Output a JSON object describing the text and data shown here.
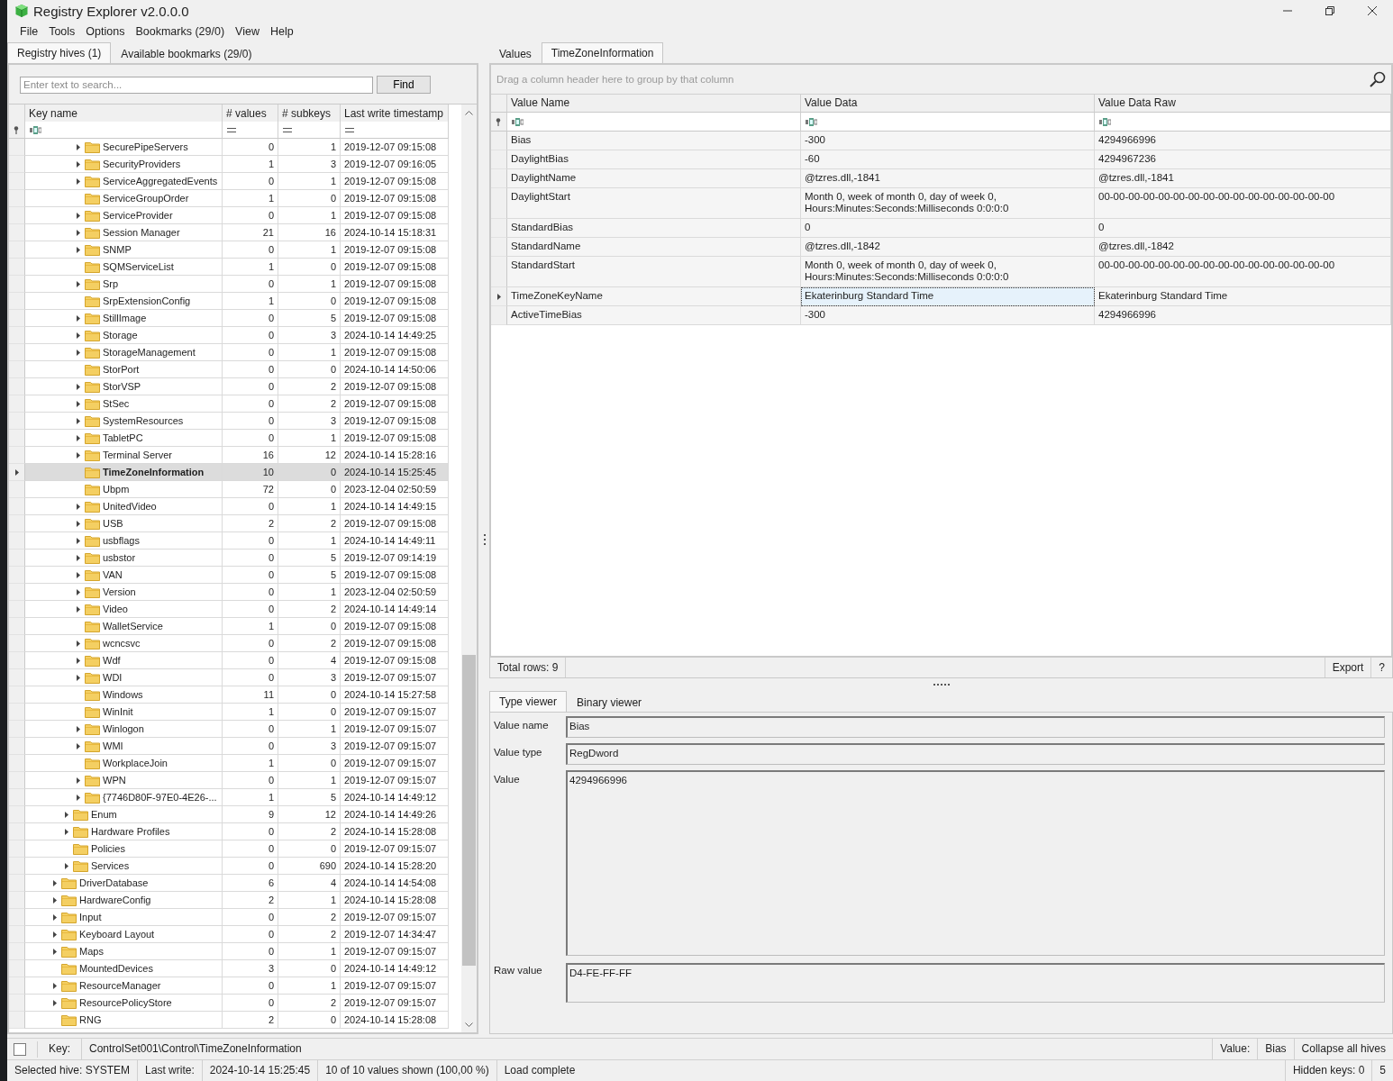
{
  "window": {
    "title": "Registry Explorer v2.0.0.0"
  },
  "menu": [
    "File",
    "Tools",
    "Options",
    "Bookmarks (29/0)",
    "View",
    "Help"
  ],
  "left_tabs": [
    {
      "label": "Registry hives (1)",
      "selected": true
    },
    {
      "label": "Available bookmarks (29/0)",
      "selected": false
    }
  ],
  "search": {
    "placeholder": "Enter text to search...",
    "button": "Find"
  },
  "key_tree": {
    "columns": [
      "Key name",
      "# values",
      "# subkeys",
      "Last write timestamp"
    ],
    "continued": {
      "continued": {
        "rows": [
          {
            "name": "SecurePipeServers",
            "values": "0",
            "subkeys": "1",
            "last_write": "2019-12-07 09:15:08",
            "expandable": true,
            "selected": false
          },
          {
            "name": "SecurityProviders",
            "values": "1",
            "subkeys": "3",
            "last_write": "2019-12-07 09:16:05",
            "expandable": true,
            "selected": false
          },
          {
            "name": "ServiceAggregatedEvents",
            "values": "0",
            "subkeys": "1",
            "last_write": "2019-12-07 09:15:08",
            "expandable": true,
            "selected": false
          },
          {
            "name": "ServiceGroupOrder",
            "values": "1",
            "subkeys": "0",
            "last_write": "2019-12-07 09:15:08",
            "expandable": false,
            "selected": false
          },
          {
            "name": "ServiceProvider",
            "values": "0",
            "subkeys": "1",
            "last_write": "2019-12-07 09:15:08",
            "expandable": true,
            "selected": false
          },
          {
            "name": "Session Manager",
            "values": "21",
            "subkeys": "16",
            "last_write": "2024-10-14 15:18:31",
            "expandable": true,
            "selected": false
          },
          {
            "name": "SNMP",
            "values": "0",
            "subkeys": "1",
            "last_write": "2019-12-07 09:15:08",
            "expandable": true,
            "selected": false
          },
          {
            "name": "SQMServiceList",
            "values": "1",
            "subkeys": "0",
            "last_write": "2019-12-07 09:15:08",
            "expandable": false,
            "selected": false
          },
          {
            "name": "Srp",
            "values": "0",
            "subkeys": "1",
            "last_write": "2019-12-07 09:15:08",
            "expandable": true,
            "selected": false
          },
          {
            "name": "SrpExtensionConfig",
            "values": "1",
            "subkeys": "0",
            "last_write": "2019-12-07 09:15:08",
            "expandable": false,
            "selected": false
          },
          {
            "name": "StillImage",
            "values": "0",
            "subkeys": "5",
            "last_write": "2019-12-07 09:15:08",
            "expandable": true,
            "selected": false
          },
          {
            "name": "Storage",
            "values": "0",
            "subkeys": "3",
            "last_write": "2024-10-14 14:49:25",
            "expandable": true,
            "selected": false
          },
          {
            "name": "StorageManagement",
            "values": "0",
            "subkeys": "1",
            "last_write": "2019-12-07 09:15:08",
            "expandable": true,
            "selected": false
          },
          {
            "name": "StorPort",
            "values": "0",
            "subkeys": "0",
            "last_write": "2024-10-14 14:50:06",
            "expandable": false,
            "selected": false
          },
          {
            "name": "StorVSP",
            "values": "0",
            "subkeys": "2",
            "last_write": "2019-12-07 09:15:08",
            "expandable": true,
            "selected": false
          },
          {
            "name": "StSec",
            "values": "0",
            "subkeys": "2",
            "last_write": "2019-12-07 09:15:08",
            "expandable": true,
            "selected": false
          },
          {
            "name": "SystemResources",
            "values": "0",
            "subkeys": "3",
            "last_write": "2019-12-07 09:15:08",
            "expandable": true,
            "selected": false
          },
          {
            "name": "TabletPC",
            "values": "0",
            "subkeys": "1",
            "last_write": "2019-12-07 09:15:08",
            "expandable": true,
            "selected": false
          },
          {
            "name": "Terminal Server",
            "values": "16",
            "subkeys": "12",
            "last_write": "2024-10-14 15:28:16",
            "expandable": true,
            "selected": false
          },
          {
            "name": "TimeZoneInformation",
            "values": "10",
            "subkeys": "0",
            "last_write": "2024-10-14 15:25:45",
            "expandable": false,
            "selected": true
          },
          {
            "name": "Ubpm",
            "values": "72",
            "subkeys": "0",
            "last_write": "2023-12-04 02:50:59",
            "expandable": false,
            "selected": false
          },
          {
            "name": "UnitedVideo",
            "values": "0",
            "subkeys": "1",
            "last_write": "2024-10-14 14:49:15",
            "expandable": true,
            "selected": false
          },
          {
            "name": "USB",
            "values": "2",
            "subkeys": "2",
            "last_write": "2019-12-07 09:15:08",
            "expandable": true,
            "selected": false
          },
          {
            "name": "usbflags",
            "values": "0",
            "subkeys": "1",
            "last_write": "2024-10-14 14:49:11",
            "expandable": true,
            "selected": false
          },
          {
            "name": "usbstor",
            "values": "0",
            "subkeys": "5",
            "last_write": "2019-12-07 09:14:19",
            "expandable": true,
            "selected": false
          },
          {
            "name": "VAN",
            "values": "0",
            "subkeys": "5",
            "last_write": "2019-12-07 09:15:08",
            "expandable": true,
            "selected": false
          },
          {
            "name": "Version",
            "values": "0",
            "subkeys": "1",
            "last_write": "2023-12-04 02:50:59",
            "expandable": true,
            "selected": false
          },
          {
            "name": "Video",
            "values": "0",
            "subkeys": "2",
            "last_write": "2024-10-14 14:49:14",
            "expandable": true,
            "selected": false
          },
          {
            "name": "WalletService",
            "values": "1",
            "subkeys": "0",
            "last_write": "2019-12-07 09:15:08",
            "expandable": false,
            "selected": false
          },
          {
            "name": "wcncsvc",
            "values": "0",
            "subkeys": "2",
            "last_write": "2019-12-07 09:15:08",
            "expandable": true,
            "selected": false
          },
          {
            "name": "Wdf",
            "values": "0",
            "subkeys": "4",
            "last_write": "2019-12-07 09:15:08",
            "expandable": true,
            "selected": false
          },
          {
            "name": "WDI",
            "values": "0",
            "subkeys": "3",
            "last_write": "2019-12-07 09:15:07",
            "expandable": true,
            "selected": false
          },
          {
            "name": "Windows",
            "values": "11",
            "subkeys": "0",
            "last_write": "2024-10-14 15:27:58",
            "expandable": false,
            "selected": false
          },
          {
            "name": "WinInit",
            "values": "1",
            "subkeys": "0",
            "last_write": "2019-12-07 09:15:07",
            "expandable": false,
            "selected": false
          },
          {
            "name": "Winlogon",
            "values": "0",
            "subkeys": "1",
            "last_write": "2019-12-07 09:15:07",
            "expandable": true,
            "selected": false
          },
          {
            "name": "WMI",
            "values": "0",
            "subkeys": "3",
            "last_write": "2019-12-07 09:15:07",
            "expandable": true,
            "selected": false
          },
          {
            "name": "WorkplaceJoin",
            "values": "1",
            "subkeys": "0",
            "last_write": "2019-12-07 09:15:07",
            "expandable": false,
            "selected": false
          },
          {
            "name": "WPN",
            "values": "0",
            "subkeys": "1",
            "last_write": "2019-12-07 09:15:07",
            "expandable": true,
            "selected": false
          },
          {
            "name": "{7746D80F-97E0-4E26-...",
            "values": "1",
            "subkeys": "5",
            "last_write": "2024-10-14 14:49:12",
            "expandable": true,
            "selected": false
          }
        ]
      },
      "rows": [
        {
          "name": "Enum",
          "values": "9",
          "subkeys": "12",
          "last_write": "2024-10-14 14:49:26",
          "expandable": true,
          "selected": false
        },
        {
          "name": "Hardware Profiles",
          "values": "0",
          "subkeys": "2",
          "last_write": "2024-10-14 15:28:08",
          "expandable": true,
          "selected": false
        },
        {
          "name": "Policies",
          "values": "0",
          "subkeys": "0",
          "last_write": "2019-12-07 09:15:07",
          "expandable": false,
          "selected": false
        },
        {
          "name": "Services",
          "values": "0",
          "subkeys": "690",
          "last_write": "2024-10-14 15:28:20",
          "expandable": true,
          "selected": false
        }
      ]
    },
    "rows": [
      {
        "name": "DriverDatabase",
        "values": "6",
        "subkeys": "4",
        "last_write": "2024-10-14 14:54:08",
        "expandable": true,
        "selected": false
      },
      {
        "name": "HardwareConfig",
        "values": "2",
        "subkeys": "1",
        "last_write": "2024-10-14 15:28:08",
        "expandable": true,
        "selected": false
      },
      {
        "name": "Input",
        "values": "0",
        "subkeys": "2",
        "last_write": "2019-12-07 09:15:07",
        "expandable": true,
        "selected": false
      },
      {
        "name": "Keyboard Layout",
        "values": "0",
        "subkeys": "2",
        "last_write": "2019-12-07 14:34:47",
        "expandable": true,
        "selected": false
      },
      {
        "name": "Maps",
        "values": "0",
        "subkeys": "1",
        "last_write": "2019-12-07 09:15:07",
        "expandable": true,
        "selected": false
      },
      {
        "name": "MountedDevices",
        "values": "3",
        "subkeys": "0",
        "last_write": "2024-10-14 14:49:12",
        "expandable": false,
        "selected": false
      },
      {
        "name": "ResourceManager",
        "values": "0",
        "subkeys": "1",
        "last_write": "2019-12-07 09:15:07",
        "expandable": true,
        "selected": false
      },
      {
        "name": "ResourcePolicyStore",
        "values": "0",
        "subkeys": "2",
        "last_write": "2019-12-07 09:15:07",
        "expandable": true,
        "selected": false
      },
      {
        "name": "RNG",
        "values": "2",
        "subkeys": "0",
        "last_write": "2024-10-14 15:28:08",
        "expandable": false,
        "selected": false
      }
    ]
  },
  "values_tabs": [
    {
      "label": "Values",
      "selected": false
    },
    {
      "label": "TimeZoneInformation",
      "selected": true
    }
  ],
  "values_grid": {
    "group_hint": "Drag a column header here to group by that column",
    "columns": [
      "Value Name",
      "Value Data",
      "Value Data Raw"
    ],
    "rows": [
      {
        "name": "Bias",
        "data": "-300",
        "raw": "4294966996",
        "selected": false
      },
      {
        "name": "DaylightBias",
        "data": "-60",
        "raw": "4294967236",
        "selected": false
      },
      {
        "name": "DaylightName",
        "data": "@tzres.dll,-1841",
        "raw": "@tzres.dll,-1841",
        "selected": false
      },
      {
        "name": "DaylightStart",
        "data": "Month 0, week of month 0, day of week 0,\nHours:Minutes:Seconds:Milliseconds 0:0:0:0",
        "raw": "00-00-00-00-00-00-00-00-00-00-00-00-00-00-00-00",
        "selected": false
      },
      {
        "name": "StandardBias",
        "data": "0",
        "raw": "0",
        "selected": false
      },
      {
        "name": "StandardName",
        "data": "@tzres.dll,-1842",
        "raw": "@tzres.dll,-1842",
        "selected": false
      },
      {
        "name": "StandardStart",
        "data": "Month 0, week of month 0, day of week 0,\nHours:Minutes:Seconds:Milliseconds 0:0:0:0",
        "raw": "00-00-00-00-00-00-00-00-00-00-00-00-00-00-00-00",
        "selected": false
      },
      {
        "name": "TimeZoneKeyName",
        "data": "Ekaterinburg Standard Time",
        "raw": "Ekaterinburg Standard Time",
        "selected": true
      },
      {
        "name": "ActiveTimeBias",
        "data": "-300",
        "raw": "4294966996",
        "selected": false
      }
    ],
    "total": "Total rows: 9",
    "export": "Export",
    "help": "?"
  },
  "viewer": {
    "tabs": [
      {
        "label": "Type viewer",
        "selected": true
      },
      {
        "label": "Binary viewer",
        "selected": false
      }
    ],
    "fields": [
      {
        "label": "Value name",
        "value": "Bias",
        "kind": "line"
      },
      {
        "label": "Value type",
        "value": "RegDword",
        "kind": "line"
      },
      {
        "label": "Value",
        "value": "4294966996",
        "kind": "area"
      },
      {
        "label": "Raw value",
        "value": "D4-FE-FF-FF",
        "kind": "raw"
      }
    ]
  },
  "key_bar": {
    "checked": false,
    "key_label": "Key:",
    "key_path": "ControlSet001\\Control\\TimeZoneInformation",
    "value_label": "Value:",
    "value_name": "Bias",
    "collapse_button": "Collapse all hives"
  },
  "status_bar": {
    "hive": "Selected hive: SYSTEM",
    "last_write_label": "Last write:",
    "last_write": "2024-10-14 15:25:45",
    "shown": "10 of 10 values shown (100,00 %)",
    "message": "Load complete",
    "hidden_keys": "Hidden keys: 0",
    "count": "5"
  }
}
